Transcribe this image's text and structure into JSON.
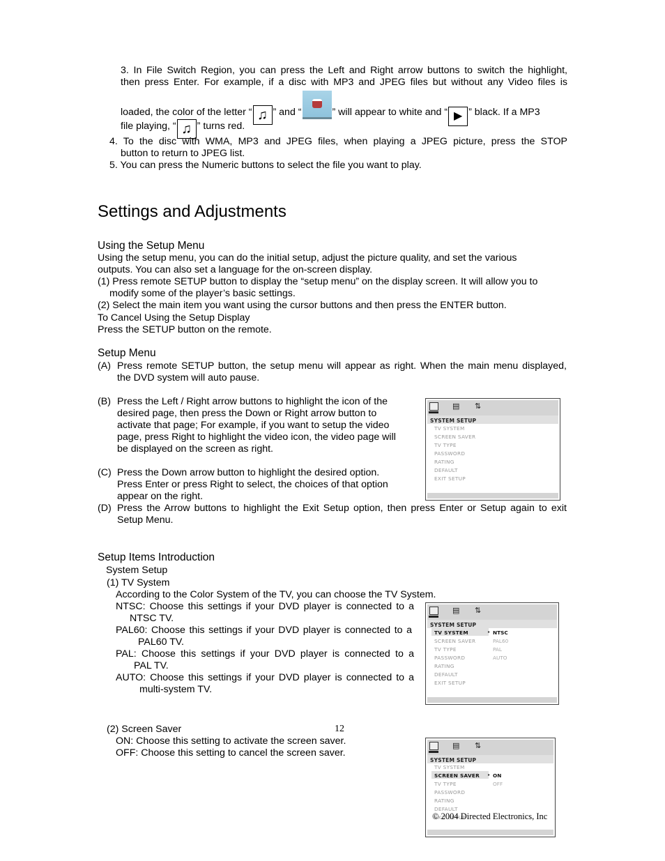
{
  "intro_list": {
    "item3": {
      "line1": "3. In File Switch Region, you can press the Left and Right arrow buttons to switch the highlight,",
      "line2": "then press Enter. For example, if a disc with MP3 and JPEG files but without any Video files is",
      "line3_a": "loaded, the color of the letter “",
      "line3_b": "” and “",
      "line3_c": "” will appear to white and “",
      "line3_d": "” black. If a MP3",
      "line4_a": "file playing, “",
      "line4_b": "” turns red.",
      "icons": [
        "music-note-icon",
        "photo-icon",
        "play-icon"
      ],
      "music_glyph": "♫",
      "play_glyph": "▶"
    },
    "item4": {
      "line1": "4. To the disc with WMA, MP3 and JPEG files, when playing a JPEG picture, press the STOP",
      "line2": "button to return to JPEG list."
    },
    "item5": "5. You can press the Numeric buttons to select the file you want to play."
  },
  "section_title": "Settings and Adjustments",
  "using_setup": {
    "heading": "Using the Setup Menu",
    "lines": [
      "Using the setup menu, you can do the initial setup, adjust the picture quality, and set the various",
      "outputs. You can also set a language for the on-screen display.",
      "(1) Press remote SETUP button to display the “setup menu” on the display screen. It will allow you to",
      "modify some of the player’s basic settings.",
      "(2) Select the main item you want using the cursor buttons and then press the ENTER button.",
      "To Cancel Using the Setup Display",
      "Press the SETUP button on the remote."
    ]
  },
  "setup_menu": {
    "heading": "Setup Menu",
    "A": {
      "label": "(A)",
      "lines": [
        "Press remote SETUP button, the setup menu will appear as right. When the main menu displayed,",
        "the DVD system will auto pause."
      ]
    },
    "B": {
      "label": "(B)",
      "lines": [
        "Press the Left / Right arrow buttons to highlight the icon of the",
        "desired page, then press the Down or Right arrow button to",
        "activate that page; For example, if you want to setup the video",
        "page, press Right to highlight the video icon, the video page will",
        "be displayed on the screen as right."
      ]
    },
    "C": {
      "label": "(C)",
      "lines": [
        "Press the Down arrow button to highlight the desired option.",
        "Press Enter or press Right to select, the choices of that option",
        "appear on the right."
      ]
    },
    "D": {
      "label": "(D)",
      "lines": [
        "Press the Arrow buttons to highlight the Exit Setup option, then press Enter or Setup again to exit",
        "Setup Menu."
      ]
    }
  },
  "setup_items": {
    "heading": "Setup Items Introduction",
    "sub": "System Setup",
    "tv_system": {
      "title": "(1) TV System",
      "intro": "According to the Color System of the TV, you can choose the TV System.",
      "lines": [
        "NTSC: Choose this settings if your DVD player is connected to a",
        "NTSC TV.",
        "PAL60: Choose this settings if your DVD player is connected to a",
        "PAL60 TV.",
        "PAL: Choose this settings if your DVD player is connected to a",
        "PAL TV.",
        "AUTO: Choose this settings if your DVD player is connected to a",
        "multi-system TV."
      ]
    },
    "screen_saver": {
      "title": "(2) Screen Saver",
      "lines": [
        "ON: Choose this setting to activate the screen saver.",
        "OFF: Choose this setting to cancel the screen saver."
      ]
    }
  },
  "osd": {
    "title": "SYSTEM  SETUP",
    "items": [
      "TV  SYSTEM",
      "SCREEN  SAVER",
      "TV  TYPE",
      "PASSWORD",
      "RATING",
      "DEFAULT",
      "EXIT  SETUP"
    ],
    "tv_options": [
      "NTSC",
      "PAL60",
      "PAL",
      "AUTO"
    ],
    "ss_options": [
      "ON",
      "OFF"
    ],
    "arrow": "▸",
    "tab_icons": [
      "system-setup-icon",
      "video-setup-icon",
      "audio-setup-icon"
    ]
  },
  "footer": {
    "page_number": "12",
    "copyright": "© 2004 Directed Electronics, Inc"
  }
}
